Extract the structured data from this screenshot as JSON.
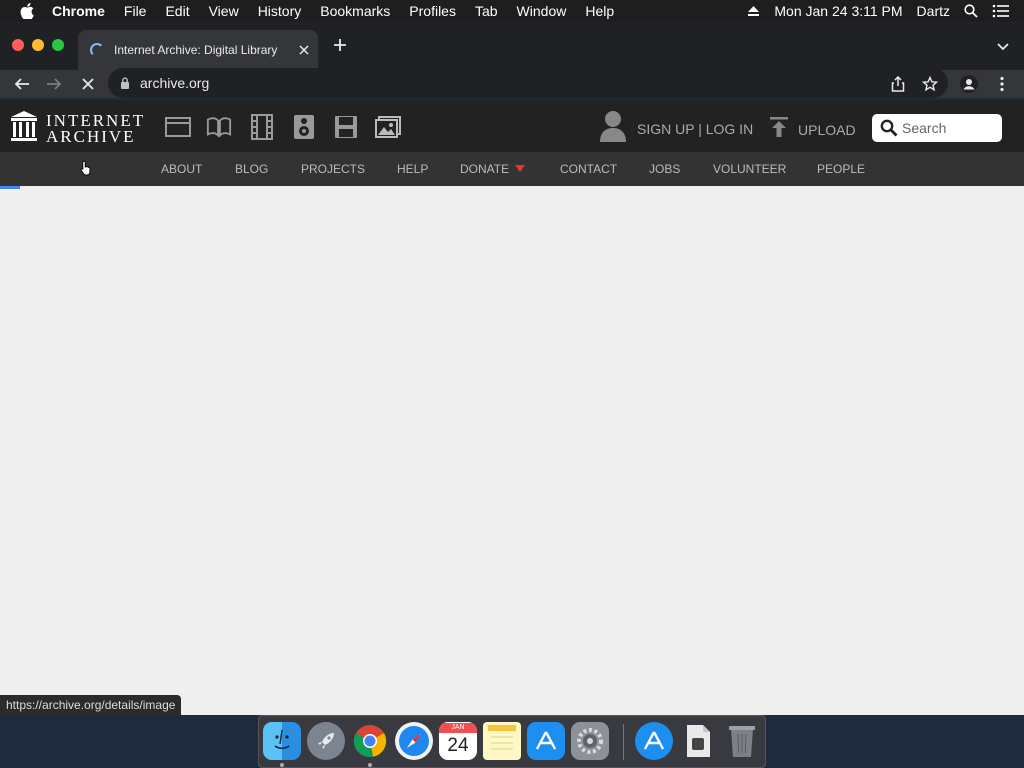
{
  "menubar": {
    "app": "Chrome",
    "items": [
      "File",
      "Edit",
      "View",
      "History",
      "Bookmarks",
      "Profiles",
      "Tab",
      "Window",
      "Help"
    ],
    "datetime": "Mon Jan 24  3:11 PM",
    "user": "Dartz"
  },
  "browser": {
    "tab_title": "Internet Archive: Digital Library",
    "url": "archive.org",
    "status_url": "https://archive.org/details/image"
  },
  "ia": {
    "logo_line1": "INTERNET",
    "logo_line2": "ARCHIVE",
    "account_label": "SIGN UP | LOG IN",
    "upload_label": "UPLOAD",
    "search_placeholder": "Search",
    "nav": [
      "ABOUT",
      "BLOG",
      "PROJECTS",
      "HELP",
      "DONATE",
      "CONTACT",
      "JOBS",
      "VOLUNTEER",
      "PEOPLE"
    ]
  },
  "dock": {
    "calendar_month": "JAN",
    "calendar_day": "24"
  },
  "colors": {
    "accent": "#4285f4",
    "donate_caret": "#e33333",
    "ia_header": "#222222",
    "ia_nav": "#333333"
  }
}
